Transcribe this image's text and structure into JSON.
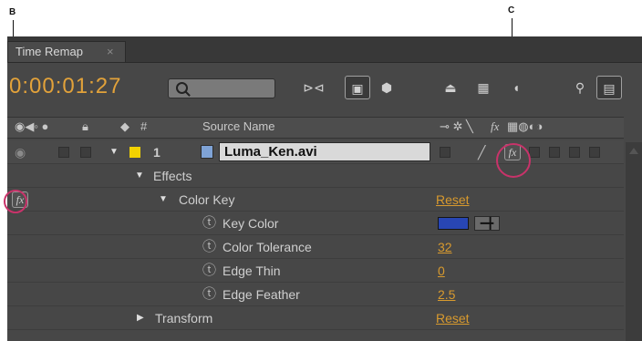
{
  "callouts": {
    "b": "B",
    "c": "C"
  },
  "tab": {
    "label": "Time Remap",
    "close": "×"
  },
  "toolbar": {
    "timecode": "0:00:01:27"
  },
  "header": {
    "hash": "#",
    "source_name": "Source Name",
    "fx_label": "fx"
  },
  "layer": {
    "number": "1",
    "name": "Luma_Ken.avi",
    "label_color": "#f2d200"
  },
  "rows": {
    "effects": "Effects",
    "color_key": {
      "label": "Color Key",
      "value": "Reset"
    },
    "key_color": {
      "label": "Key Color",
      "swatch": "#2846b4"
    },
    "color_tolerance": {
      "label": "Color Tolerance",
      "value": "32"
    },
    "edge_thin": {
      "label": "Edge Thin",
      "value": "0"
    },
    "edge_feather": {
      "label": "Edge Feather",
      "value": "2.5"
    },
    "transform": {
      "label": "Transform",
      "value": "Reset"
    }
  },
  "fx_icon_label": "fx",
  "colors": {
    "accent": "#e2a23a",
    "highlight_circle": "#c8336a",
    "panel_bg": "#474747"
  }
}
